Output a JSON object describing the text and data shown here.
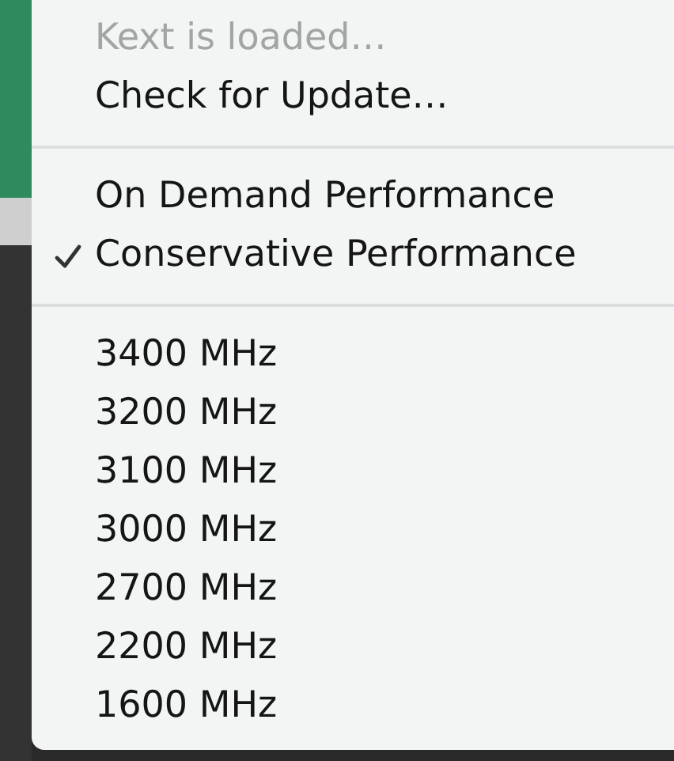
{
  "menu": {
    "sections": [
      {
        "items": [
          {
            "label": "Kext is loaded…",
            "disabled": true,
            "checked": false
          },
          {
            "label": "Check for Update…",
            "disabled": false,
            "checked": false
          }
        ]
      },
      {
        "items": [
          {
            "label": "On Demand Performance",
            "disabled": false,
            "checked": false
          },
          {
            "label": "Conservative Performance",
            "disabled": false,
            "checked": true
          }
        ]
      },
      {
        "items": [
          {
            "label": "3400 MHz",
            "disabled": false,
            "checked": false
          },
          {
            "label": "3200 MHz",
            "disabled": false,
            "checked": false
          },
          {
            "label": "3100 MHz",
            "disabled": false,
            "checked": false
          },
          {
            "label": "3000 MHz",
            "disabled": false,
            "checked": false
          },
          {
            "label": "2700 MHz",
            "disabled": false,
            "checked": false
          },
          {
            "label": "2200 MHz",
            "disabled": false,
            "checked": false
          },
          {
            "label": "1600 MHz",
            "disabled": false,
            "checked": false
          }
        ]
      }
    ]
  }
}
